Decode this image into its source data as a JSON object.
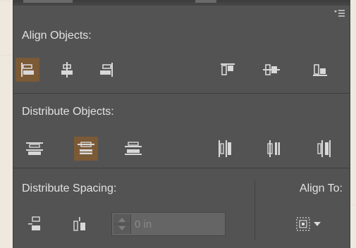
{
  "panel": {
    "align_objects": {
      "title": "Align Objects:",
      "buttons": [
        {
          "name": "horizontal-align-left",
          "active": true
        },
        {
          "name": "horizontal-align-center",
          "active": false
        },
        {
          "name": "horizontal-align-right",
          "active": false
        },
        {
          "name": "vertical-align-top",
          "active": false
        },
        {
          "name": "vertical-align-center",
          "active": false
        },
        {
          "name": "vertical-align-bottom",
          "active": false
        }
      ]
    },
    "distribute_objects": {
      "title": "Distribute Objects:",
      "buttons": [
        {
          "name": "vertical-distribute-top",
          "active": false
        },
        {
          "name": "vertical-distribute-center",
          "active": true
        },
        {
          "name": "vertical-distribute-bottom",
          "active": false
        },
        {
          "name": "horizontal-distribute-left",
          "active": false
        },
        {
          "name": "horizontal-distribute-center",
          "active": false
        },
        {
          "name": "horizontal-distribute-right",
          "active": false
        }
      ]
    },
    "distribute_spacing": {
      "title": "Distribute Spacing:",
      "spacing_value_placeholder": "0 in",
      "buttons": [
        {
          "name": "vertical-distribute-space"
        },
        {
          "name": "horizontal-distribute-space"
        }
      ]
    },
    "align_to": {
      "title": "Align To:",
      "icon": "align-to-selection-icon"
    }
  },
  "colors": {
    "panel_bg": "#535353",
    "active_bg": "#7b5a36",
    "text": "#e2e2e2",
    "icon": "#d8d8d8"
  }
}
